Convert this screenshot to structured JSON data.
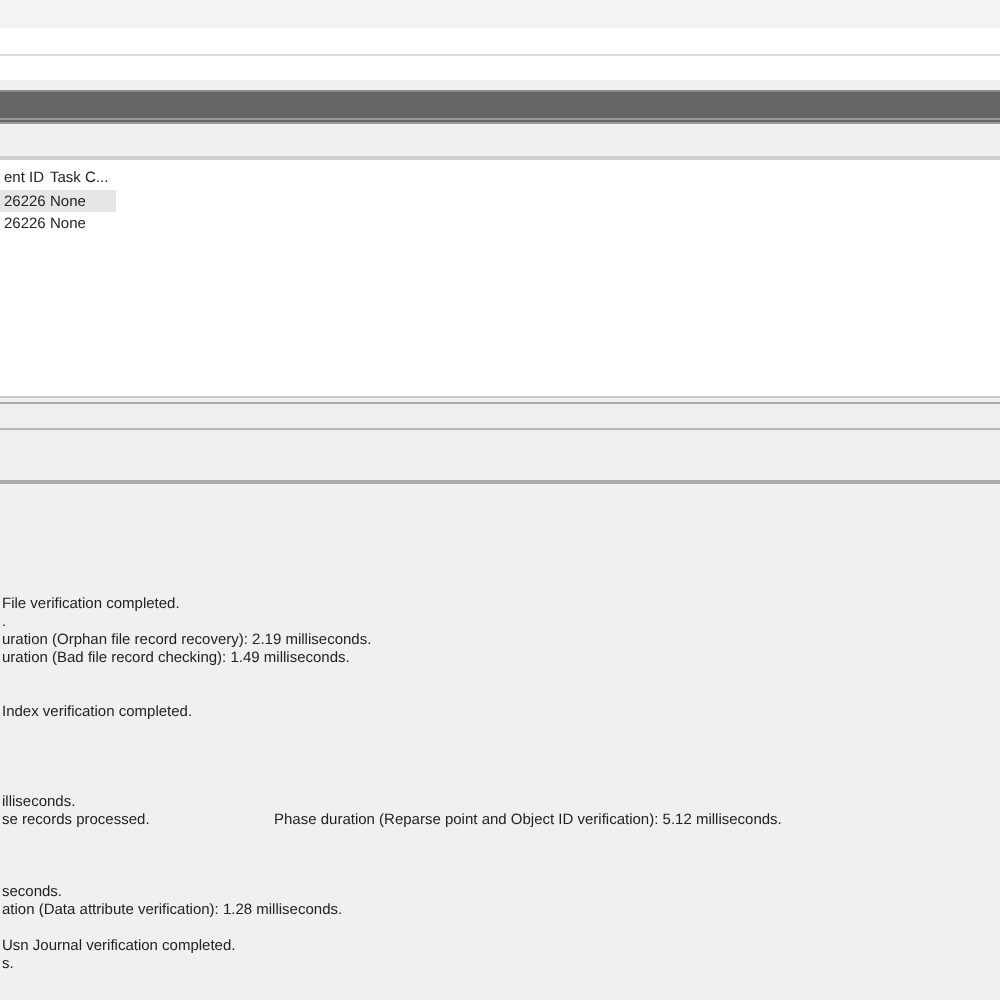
{
  "table": {
    "columns": [
      "ent ID",
      "Task C..."
    ],
    "rows": [
      {
        "cells": [
          "26226",
          "None"
        ],
        "selected": true
      },
      {
        "cells": [
          "26226",
          "None"
        ],
        "selected": false
      }
    ]
  },
  "log": {
    "groups": [
      {
        "lines": [
          {
            "text": "File verification completed."
          },
          {
            "text": "."
          },
          {
            "text": "uration (Orphan file record recovery): 2.19 milliseconds."
          },
          {
            "text": "uration (Bad file record checking): 1.49 milliseconds."
          }
        ]
      },
      {
        "lines": [
          {
            "text": "Index verification completed."
          }
        ]
      },
      {
        "lines": [
          {
            "text": "illiseconds."
          },
          {
            "text": "se records processed.",
            "column_2": "Phase duration (Reparse point and Object ID verification): 5.12 milliseconds."
          }
        ]
      },
      {
        "lines": [
          {
            "text": "seconds."
          },
          {
            "text": "ation (Data attribute verification): 1.28 milliseconds."
          }
        ]
      },
      {
        "lines": [
          {
            "text": "Usn Journal verification completed."
          },
          {
            "text": "s."
          }
        ]
      }
    ]
  }
}
